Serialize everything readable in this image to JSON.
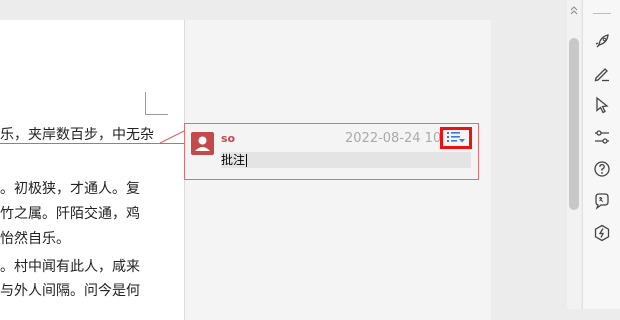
{
  "document": {
    "lines": [
      "乐，夹岸数百步，中无杂",
      "。初极狭，才通人。复",
      "竹之属。阡陌交通，鸡",
      "怡然自乐。",
      "。村中闻有此人，咸来",
      "与外人间隔。问今是何"
    ]
  },
  "comment": {
    "author": "so",
    "timestamp": "2022-08-24 10:1",
    "text": "批注"
  },
  "icons": {
    "avatar": "user-avatar-icon",
    "menu": "comment-menu-icon",
    "rail": [
      "rocket-icon",
      "pen-icon",
      "cursor-icon",
      "sliders-icon",
      "help-icon",
      "translate-icon",
      "share-icon"
    ]
  },
  "colors": {
    "accent": "#c44a4a",
    "highlight_border": "#e11111",
    "menu_icon": "#3a7bd5"
  }
}
